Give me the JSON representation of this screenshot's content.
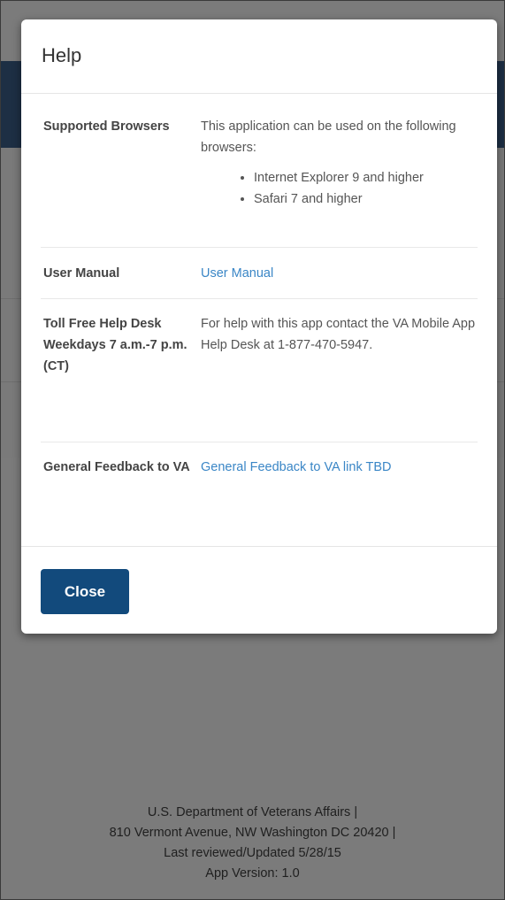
{
  "modal": {
    "title": "Help",
    "rows": [
      {
        "label": "Supported Browsers",
        "text": "This application can be used on the following browsers:",
        "list": [
          "Internet Explorer 9 and higher",
          "Safari 7 and higher"
        ]
      },
      {
        "label": "User Manual",
        "link": "User Manual"
      },
      {
        "label": "Toll Free Help Desk Weekdays 7 a.m.-7 p.m. (CT)",
        "text": "For help with this app contact the VA Mobile App Help Desk at 1-877-470-5947."
      },
      {
        "label": "General Feedback to VA",
        "link": "General Feedback to VA link TBD"
      }
    ],
    "close_label": "Close"
  },
  "footer": {
    "line1": "U.S. Department of Veterans Affairs |",
    "line2": "810 Vermont Avenue, NW Washington DC 20420 |",
    "line3": "Last reviewed/Updated 5/28/15",
    "line4": "App Version: 1.0"
  },
  "colors": {
    "primary_button": "#124a7c",
    "link": "#3a86c6",
    "overlay": "#7b7b7b",
    "header_bg": "#1d2f44"
  }
}
